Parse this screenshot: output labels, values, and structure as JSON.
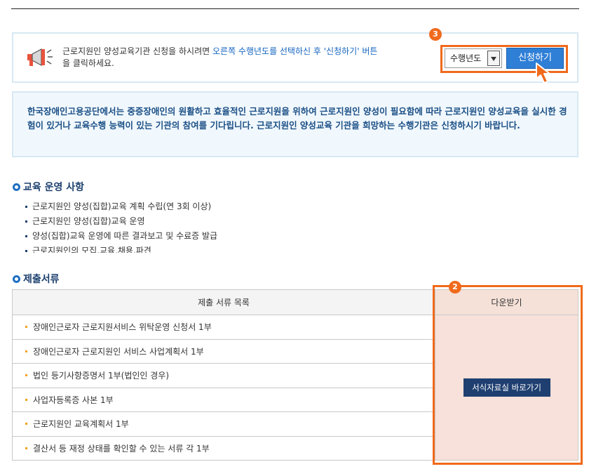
{
  "notice": {
    "text_before": "근로지원인 양성교육기관 신청을 하시려면 ",
    "text_highlight": "오른쪽 수행년도를 선택하신 후 '신청하기' 버튼",
    "text_after": "을 클릭하세요."
  },
  "controls": {
    "year_select_value": "수행년도",
    "apply_button": "신청하기",
    "marker_3": "3",
    "marker_2": "2"
  },
  "info": {
    "text": "한국장애인고용공단에서는 중증장애인의 원활하고 효율적인 근로지원을 위하여 근로지원인 양성이 필요함에 따라 근로지원인 양성교육을 실시한 경험이 있거나 교육수행 능력이 있는 기관의 참여를 기다립니다. 근로지원인 양성교육 기관을 희망하는 수행기관은 신청하시기 바랍니다."
  },
  "section_operation": {
    "title": "교육 운영 사항",
    "items": [
      "근로지원인 양성(집합)교육 계획 수립(연 3회 이상)",
      "근로지원인 양성(집합)교육 운영",
      "양성(집합)교육 운영에 따른 결과보고 및 수료증 발급",
      "근로지원인의 모집,교육,채용,파견"
    ]
  },
  "section_documents": {
    "title": "제출서류",
    "col_list": "제출 서류 목록",
    "col_download": "다운받기",
    "rows": [
      "장애인근로자 근로지원서비스 위탁운영 신청서 1부",
      "장애인근로자 근로지원인 서비스 사업계획서 1부",
      "법인 등기사항증명서 1부(법인인 경우)",
      "사업자등록증 사본 1부",
      "근로지원인 교육계획서 1부",
      "결산서 등 재정 상태를 확인할 수 있는 서류 각 1부"
    ],
    "download_button": "서식자료실 바로가기"
  },
  "colors": {
    "accent_orange": "#f06a1c",
    "button_blue": "#2f7fd6",
    "navy": "#1f3f71",
    "info_text": "#1b4f86"
  },
  "icons": [
    "megaphone-icon",
    "cursor-arrow-icon",
    "ring-bullet-icon",
    "dropdown-arrow-icon"
  ]
}
